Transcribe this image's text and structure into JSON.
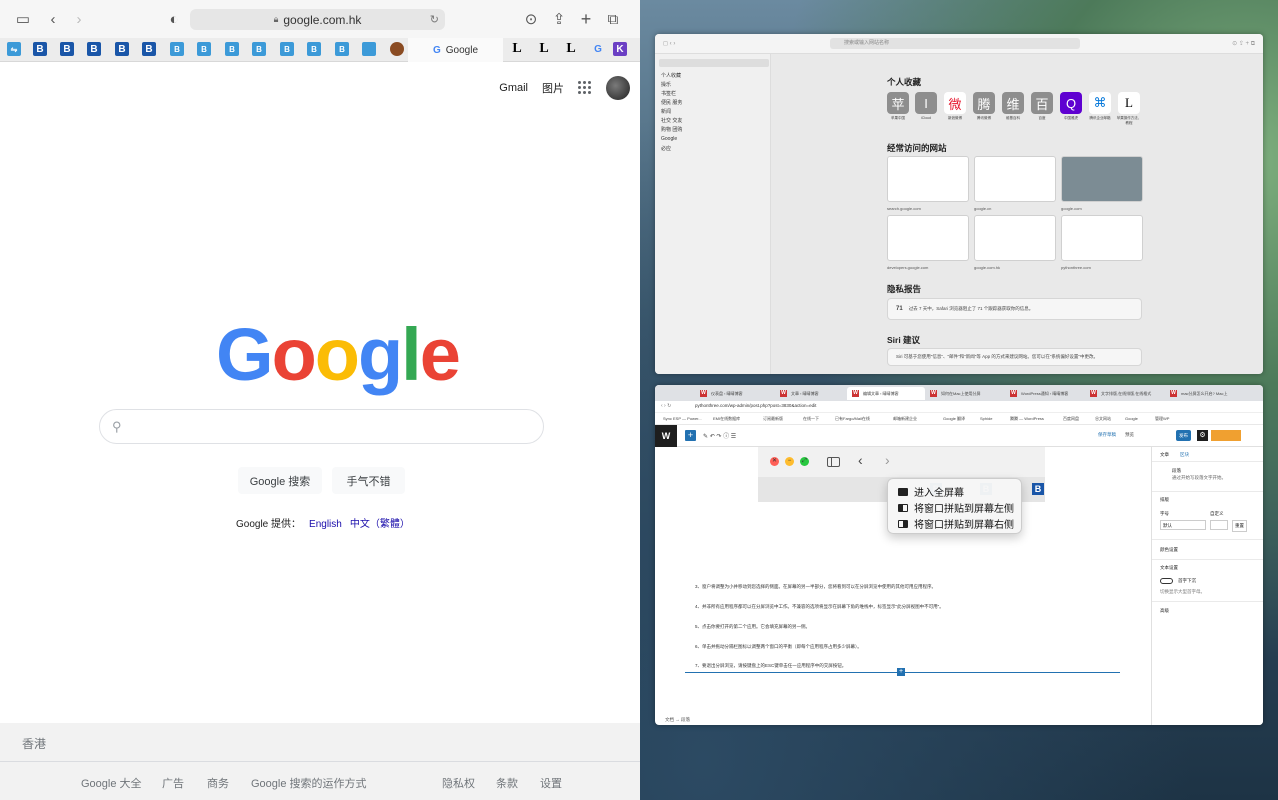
{
  "left": {
    "address": "google.com.hk",
    "active_tab": "Google",
    "favorites": [
      "B",
      "B",
      "B",
      "B",
      "B",
      "B",
      "B",
      "B",
      "B",
      "B",
      "B",
      "B",
      "L",
      "L",
      "L",
      "G",
      "K"
    ],
    "header_links": [
      "Gmail",
      "图片"
    ],
    "logo": [
      "G",
      "o",
      "o",
      "g",
      "l",
      "e"
    ],
    "buttons": [
      "Google 搜索",
      "手气不错"
    ],
    "offered_label": "Google 提供：",
    "languages": [
      "English",
      "中文（繁體）"
    ],
    "footer": {
      "region": "香港",
      "links_left": [
        "Google 大全",
        "广告",
        "商务",
        "Google 搜索的运作方式"
      ],
      "links_right": [
        "隐私权",
        "条款",
        "设置"
      ]
    }
  },
  "right_top": {
    "address_placeholder": "搜索或输入网站名称",
    "sidebar_items": [
      "个人收藏",
      "操乐",
      "书签栏",
      "便民 服务",
      "新闻",
      "社交 交友",
      "购物 团购",
      "Google",
      "必应"
    ],
    "favorites_title": "个人收藏",
    "favorites": [
      {
        "glyph": "苹",
        "label": "苹果中国"
      },
      {
        "glyph": "I",
        "label": "iCloud"
      },
      {
        "glyph": "微",
        "label": "新浪微博"
      },
      {
        "glyph": "腾",
        "label": "腾讯微博"
      },
      {
        "glyph": "维",
        "label": "维基百科"
      },
      {
        "glyph": "百",
        "label": "百度"
      },
      {
        "glyph": "Q",
        "label": "中国雅虎"
      },
      {
        "glyph": "⌘",
        "label": "腾讯企业邮箱"
      },
      {
        "glyph": "L",
        "label": "苹果操作方法、教程"
      }
    ],
    "frequent_title": "经常访问的网站",
    "frequent": [
      "search.google.com",
      "google.cn",
      "google.com",
      "developers.google.com",
      "google.com.hk",
      "pythonthree.com"
    ],
    "privacy_title": "隐私报告",
    "privacy_count": "71",
    "privacy_text": "过去 7 天中，Safari 浏览器阻止了 71 个跟踪器获取你的信息。",
    "siri_title": "Siri 建议",
    "siri_text": "Siri 可基于您使用\"信息\"、\"邮件\"和\"新闻\"等 App 的方式来建议网站。您可以在\"系统偏好设置\"中更改。"
  },
  "right_bottom": {
    "tabs": [
      "仪表盘 ‹ 晴晴博客",
      "文章 ‹ 晴晴博客",
      "编辑文章 ‹ 晴晴博客",
      "如何在Mac上使用分屏",
      "WordPress通知 ‹ 晴晴博客",
      "文字排版,在线排版,在线格式",
      "mac分屏怎么开启? Mac上"
    ],
    "url": "pythonthree.com/wp-admin/post.php?post=3830&action=edit",
    "bookmarks": [
      "Sync ESP — Power...",
      "EMI在线数据库",
      "订阅最新版",
      "在线一下",
      "已有Fargo/Mail在线",
      "邮箱新建企业",
      "Google 翻译",
      "Sphide",
      "腾腾 — WordPress",
      "百度网盘",
      "谷文网站",
      "Google",
      "管理WP"
    ],
    "top_actions": [
      "保存草稿",
      "预览"
    ],
    "publish": "发布",
    "menu": [
      "进入全屏幕",
      "将窗口拼贴到屏幕左侧",
      "将窗口拼贴到屏幕右侧"
    ],
    "paragraphs": [
      "3、窗户将调整为小并移动到您选择的侧面。在屏幕的另一半部分，您将看到可以在分屏浏览中使用的其他可用应用程序。",
      "4、并非所有应用程序都可以在分屏浏览中工作。不兼容的选项将显示在屏幕下角的堆栈中，标签显示\"此分屏视图中不可用\"。",
      "5、点击你要打开的第二个应用。它会填充屏幕的另一侧。",
      "6、单击并拖动分隔栏图标以调整两个窗口的平衡（即每个应用程序占用多少屏幕）。",
      "7、要退出分屏浏览，请按键盘上的ESC键单击任一应用程序中的交屏按钮。"
    ],
    "inspector": {
      "tabs": [
        "文章",
        "区块"
      ],
      "block_name": "段落",
      "block_desc": "通过开始写段落文字开始。",
      "typography": "排版",
      "size_label": "字号",
      "custom_label": "自定义",
      "size_value": "默认",
      "reset": "重置",
      "color": "颜色设置",
      "text_settings": "文本设置",
      "dropcap": "首字下沉",
      "dropcap_hint": "切换显示大型首字母。",
      "advanced": "高级"
    },
    "breadcrumb": "文档 → 段落"
  }
}
